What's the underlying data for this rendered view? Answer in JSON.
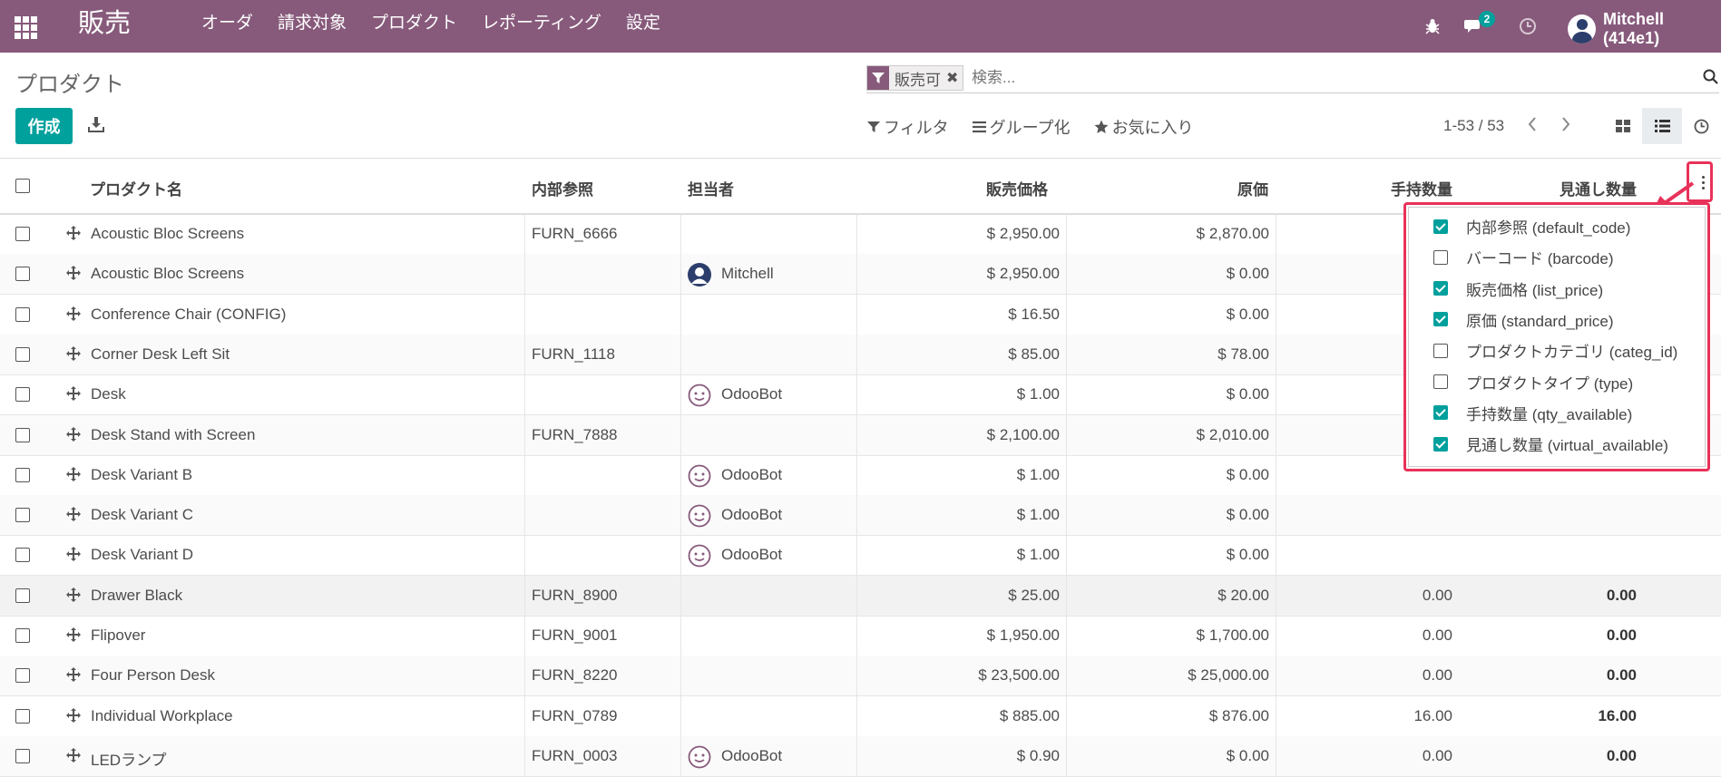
{
  "topbar": {
    "app_name": "販売",
    "menu": [
      "オーダ",
      "請求対象",
      "プロダクト",
      "レポーティング",
      "設定"
    ],
    "message_count": "2",
    "user_name": "Mitchell (414e1)"
  },
  "page": {
    "title": "プロダクト",
    "create_label": "作成",
    "search_facet": "販売可",
    "search_placeholder": "検索...",
    "filter_label": "フィルタ",
    "group_label": "グループ化",
    "favorite_label": "お気に入り",
    "pager": "1-53 / 53"
  },
  "columns": {
    "name": "プロダクト名",
    "default_code": "内部参照",
    "responsible": "担当者",
    "list_price": "販売価格",
    "standard_price": "原価",
    "qty_available": "手持数量",
    "virtual_available": "見通し数量"
  },
  "rows": [
    {
      "name": "Acoustic Bloc Screens",
      "code": "FURN_6666",
      "responsible": "",
      "avatar": "",
      "price": "$ 2,950.00",
      "cost": "$ 2,870.00",
      "qty": "",
      "virtual": ""
    },
    {
      "name": "Acoustic Bloc Screens",
      "code": "",
      "responsible": "Mitchell",
      "avatar": "user",
      "price": "$ 2,950.00",
      "cost": "$ 0.00",
      "qty": "",
      "virtual": ""
    },
    {
      "name": "Conference Chair (CONFIG)",
      "code": "",
      "responsible": "",
      "avatar": "",
      "price": "$ 16.50",
      "cost": "$ 0.00",
      "qty": "",
      "virtual": ""
    },
    {
      "name": "Corner Desk Left Sit",
      "code": "FURN_1118",
      "responsible": "",
      "avatar": "",
      "price": "$ 85.00",
      "cost": "$ 78.00",
      "qty": "",
      "virtual": ""
    },
    {
      "name": "Desk",
      "code": "",
      "responsible": "OdooBot",
      "avatar": "bot",
      "price": "$ 1.00",
      "cost": "$ 0.00",
      "qty": "",
      "virtual": ""
    },
    {
      "name": "Desk Stand with Screen",
      "code": "FURN_7888",
      "responsible": "",
      "avatar": "",
      "price": "$ 2,100.00",
      "cost": "$ 2,010.00",
      "qty": "",
      "virtual": ""
    },
    {
      "name": "Desk Variant B",
      "code": "",
      "responsible": "OdooBot",
      "avatar": "bot",
      "price": "$ 1.00",
      "cost": "$ 0.00",
      "qty": "",
      "virtual": ""
    },
    {
      "name": "Desk Variant C",
      "code": "",
      "responsible": "OdooBot",
      "avatar": "bot",
      "price": "$ 1.00",
      "cost": "$ 0.00",
      "qty": "",
      "virtual": ""
    },
    {
      "name": "Desk Variant D",
      "code": "",
      "responsible": "OdooBot",
      "avatar": "bot",
      "price": "$ 1.00",
      "cost": "$ 0.00",
      "qty": "",
      "virtual": ""
    },
    {
      "name": "Drawer Black",
      "code": "FURN_8900",
      "responsible": "",
      "avatar": "",
      "price": "$ 25.00",
      "cost": "$ 20.00",
      "qty": "0.00",
      "virtual": "0.00"
    },
    {
      "name": "Flipover",
      "code": "FURN_9001",
      "responsible": "",
      "avatar": "",
      "price": "$ 1,950.00",
      "cost": "$ 1,700.00",
      "qty": "0.00",
      "virtual": "0.00"
    },
    {
      "name": "Four Person Desk",
      "code": "FURN_8220",
      "responsible": "",
      "avatar": "",
      "price": "$ 23,500.00",
      "cost": "$ 25,000.00",
      "qty": "0.00",
      "virtual": "0.00"
    },
    {
      "name": "Individual Workplace",
      "code": "FURN_0789",
      "responsible": "",
      "avatar": "",
      "price": "$ 885.00",
      "cost": "$ 876.00",
      "qty": "16.00",
      "virtual": "16.00"
    },
    {
      "name": "LEDランプ",
      "code": "FURN_0003",
      "responsible": "OdooBot",
      "avatar": "bot",
      "price": "$ 0.90",
      "cost": "$ 0.00",
      "qty": "0.00",
      "virtual": "0.00"
    }
  ],
  "column_menu": [
    {
      "label": "内部参照 (default_code)",
      "checked": true
    },
    {
      "label": "バーコード (barcode)",
      "checked": false
    },
    {
      "label": "販売価格 (list_price)",
      "checked": true
    },
    {
      "label": "原価 (standard_price)",
      "checked": true
    },
    {
      "label": "プロダクトカテゴリ (categ_id)",
      "checked": false
    },
    {
      "label": "プロダクトタイプ (type)",
      "checked": false
    },
    {
      "label": "手持数量 (qty_available)",
      "checked": true
    },
    {
      "label": "見通し数量 (virtual_available)",
      "checked": true
    }
  ],
  "colors": {
    "brand": "#875a7b",
    "accent": "#00a09d",
    "highlight": "#e8325a"
  },
  "icons": [
    "apps-grid-icon",
    "bug-icon",
    "chat-icon",
    "clock-icon",
    "filter-icon",
    "download-icon",
    "search-icon",
    "funnel-icon",
    "list-lines-icon",
    "star-icon",
    "chevron-left-icon",
    "chevron-right-icon",
    "kanban-icon",
    "list-view-icon",
    "activity-icon",
    "move-handle-icon",
    "optional-columns-icon"
  ]
}
